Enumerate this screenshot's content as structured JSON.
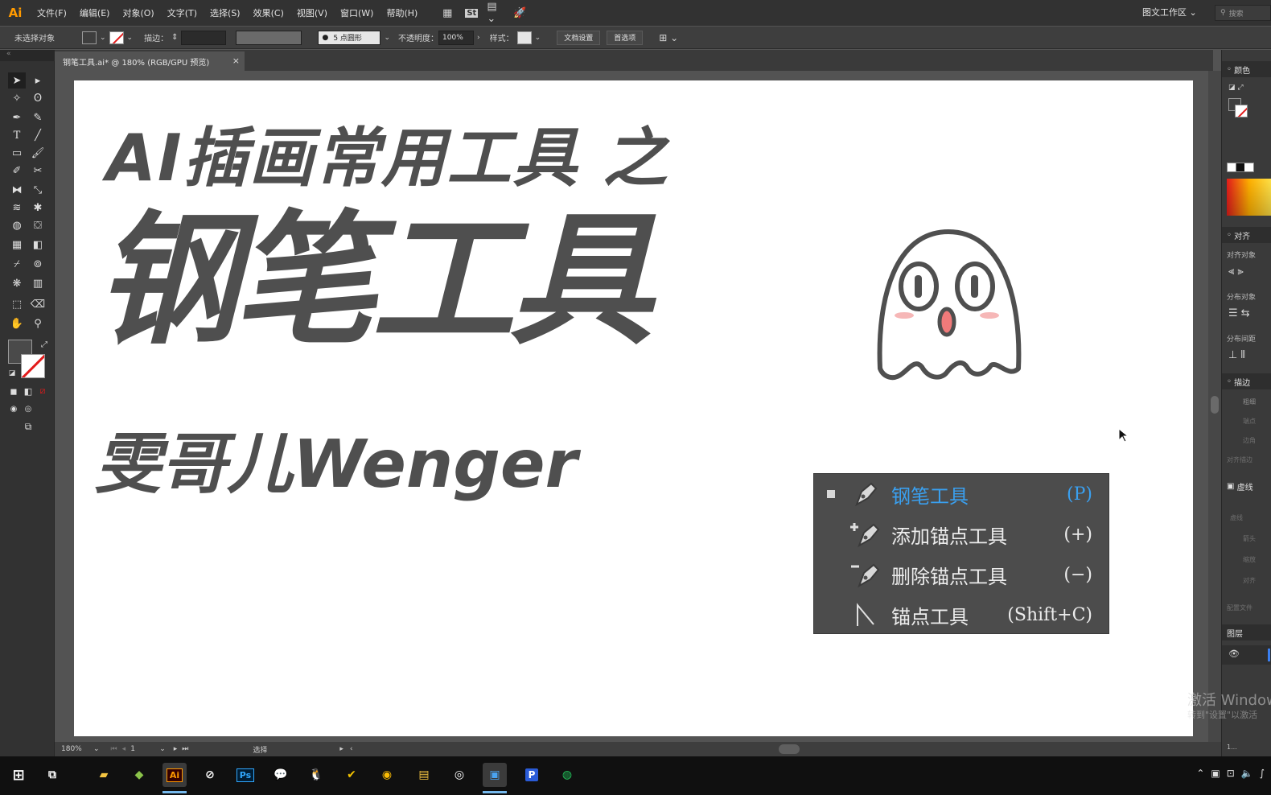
{
  "app": {
    "logo": "Ai"
  },
  "menu": [
    "文件(F)",
    "编辑(E)",
    "对象(O)",
    "文字(T)",
    "选择(S)",
    "效果(C)",
    "视图(V)",
    "窗口(W)",
    "帮助(H)"
  ],
  "menubar_icons": {
    "st": "St"
  },
  "workspace": {
    "label": "图文工作区 ⌄"
  },
  "search": {
    "placeholder": "搜索"
  },
  "control_bar": {
    "selection_status": "未选择对象",
    "stroke_label": "描边：",
    "brush_size": "5 点圆形",
    "opacity_label": "不透明度：",
    "opacity_value": "100%",
    "style_label": "样式：",
    "document_setup": "文档设置",
    "preferences": "首选项"
  },
  "document": {
    "tab_title": "钢笔工具.ai* @ 180% (RGB/GPU 预览)",
    "close": "×"
  },
  "artboard": {
    "title_line1": "AI插画常用工具 之",
    "title_line2": "钢笔工具",
    "title_line3": "雯哥儿Wenger"
  },
  "tool_popup": {
    "items": [
      {
        "label": "钢笔工具",
        "shortcut": "(P)",
        "icon": "pen-tool-icon",
        "selected": true
      },
      {
        "label": "添加锚点工具",
        "shortcut": "(+)",
        "icon": "add-anchor-point-icon",
        "selected": false
      },
      {
        "label": "删除锚点工具",
        "shortcut": "(−)",
        "icon": "delete-anchor-point-icon",
        "selected": false
      },
      {
        "label": "锚点工具",
        "shortcut": "(Shift+C)",
        "icon": "anchor-point-tool-icon",
        "selected": false
      }
    ]
  },
  "status_bar": {
    "zoom": "180%",
    "artboard_number": "1",
    "tool_name": "选择"
  },
  "panels": {
    "color": "颜色",
    "align": "对齐",
    "align_objects": "对齐对象",
    "distribute_objects": "分布对象",
    "distribute_spacing": "分布间距",
    "stroke": "描边",
    "stroke_weight": "粗细",
    "stroke_dim_labels": [
      "端点",
      "边角",
      "对齐描边"
    ],
    "dashed": "虚线",
    "dashed_dim_labels": [
      "虚线",
      "箭头",
      "缩放",
      "对齐",
      "配置文件"
    ],
    "layers": "图层",
    "layers_count": "1..."
  },
  "watermark": {
    "line1": "激活 Windows",
    "line2": "转到\"设置\"以激活"
  },
  "colors": {
    "accent_blue": "#3aa0f0",
    "ai_orange": "#ff9a00",
    "title_gray": "#4f4f4f"
  }
}
